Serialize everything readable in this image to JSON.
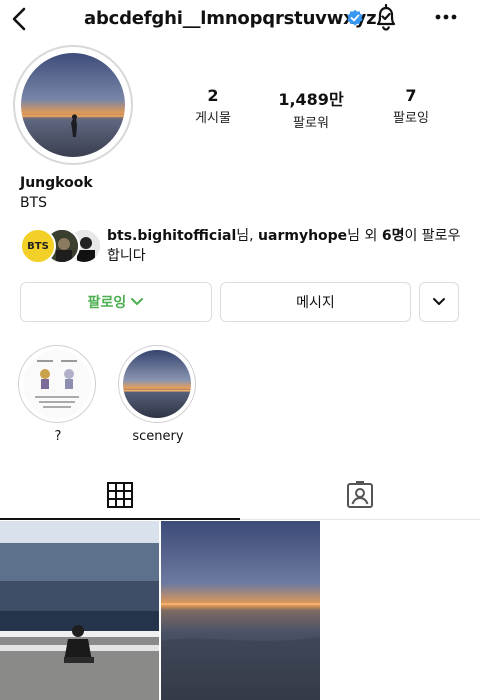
{
  "header": {
    "username": "abcdefghi__lmnopqrstuvwxyz",
    "icons": {
      "back": "chevron-left-icon",
      "verified": "verified-badge-icon",
      "bell": "bell-icon",
      "more": "more-dots-icon"
    }
  },
  "profile": {
    "stats": [
      {
        "value": "2",
        "label": "게시물"
      },
      {
        "value": "1,489만",
        "label": "팔로워"
      },
      {
        "value": "7",
        "label": "팔로잉"
      }
    ],
    "name": "Jungkook",
    "bio": "BTS",
    "followed_by": {
      "first": "bts.bighitofficial",
      "suffix1": "님, ",
      "second": "uarmyhope",
      "suffix2": "님 외 ",
      "count": "6명",
      "suffix3": "이 팔로우합니다"
    },
    "follower_avatar_text": "BTS"
  },
  "buttons": {
    "following": "팔로잉",
    "message": "메시지"
  },
  "highlights": [
    {
      "label": "?"
    },
    {
      "label": "scenery"
    }
  ],
  "colors": {
    "accent_green": "#4caf50",
    "verified_blue": "#3897f0",
    "bts_yellow": "#f2d027"
  }
}
